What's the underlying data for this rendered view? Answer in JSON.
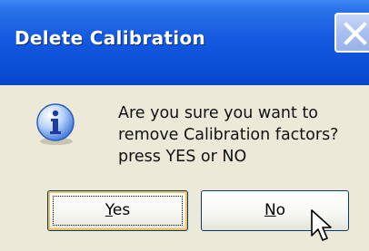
{
  "dialog": {
    "title": "Delete Calibration",
    "message_lines": [
      "Are you sure you want to",
      "remove Calibration factors?",
      "press  YES  or  NO"
    ],
    "icon": "information-icon"
  },
  "buttons": {
    "yes": {
      "mnemonic": "Y",
      "rest": "es"
    },
    "no": {
      "mnemonic": "N",
      "rest": "o"
    }
  },
  "colors": {
    "titlebar": "#0a4fd6",
    "dialog_bg": "#ece9d8",
    "focus_highlight": "#f1c055"
  }
}
